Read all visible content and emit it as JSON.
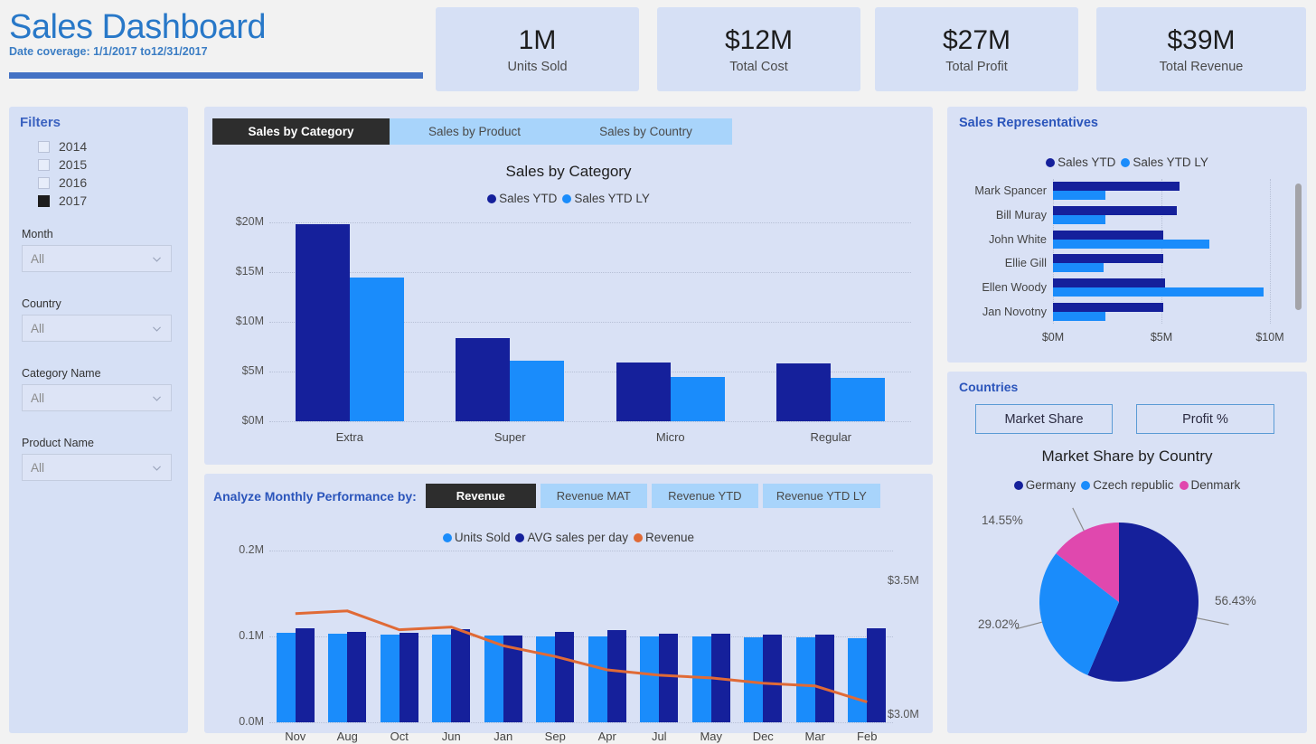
{
  "header": {
    "title": "Sales Dashboard",
    "subtitle": "Date coverage: 1/1/2017 to12/31/2017",
    "kpis": [
      {
        "value": "1M",
        "label": "Units Sold"
      },
      {
        "value": "$12M",
        "label": "Total Cost"
      },
      {
        "value": "$27M",
        "label": "Total Profit"
      },
      {
        "value": "$39M",
        "label": "Total Revenue"
      }
    ]
  },
  "sidebar": {
    "title": "Filters",
    "years": [
      {
        "label": "2014",
        "checked": false
      },
      {
        "label": "2015",
        "checked": false
      },
      {
        "label": "2016",
        "checked": false
      },
      {
        "label": "2017",
        "checked": true
      }
    ],
    "selects": [
      {
        "label": "Month",
        "value": "All"
      },
      {
        "label": "Country",
        "value": "All"
      },
      {
        "label": "Category Name",
        "value": "All"
      },
      {
        "label": "Product Name",
        "value": "All"
      }
    ]
  },
  "category_panel": {
    "tabs": [
      {
        "label": "Sales by Category",
        "active": true
      },
      {
        "label": "Sales by Product",
        "active": false
      },
      {
        "label": "Sales by Country",
        "active": false
      }
    ]
  },
  "monthly_panel": {
    "head_label": "Analyze Monthly Performance by:",
    "tabs": [
      {
        "label": "Revenue",
        "active": true
      },
      {
        "label": "Revenue MAT",
        "active": false
      },
      {
        "label": "Revenue YTD",
        "active": false
      },
      {
        "label": "Revenue YTD LY",
        "active": false
      }
    ]
  },
  "reps_panel": {
    "title": "Sales Representatives"
  },
  "countries_panel": {
    "title": "Countries",
    "buttons": [
      {
        "label": "Market Share"
      },
      {
        "label": "Profit %"
      }
    ]
  },
  "colors": {
    "navy": "#15209b",
    "blue": "#1a8cfb",
    "pink": "#e048ae",
    "orange": "#e06a36",
    "accent": "#2878c8",
    "rule": "#4472c4",
    "panel": "#d6e0f5",
    "page": "#f2f2f2"
  },
  "chart_data": [
    {
      "type": "bar",
      "id": "sales-by-category",
      "title": "Sales by Category",
      "xlabel": "",
      "ylabel": "",
      "ylim": [
        0,
        20
      ],
      "yticks": [
        "$0M",
        "$5M",
        "$10M",
        "$15M",
        "$20M"
      ],
      "ytick_values": [
        0,
        5,
        10,
        15,
        20
      ],
      "grid": true,
      "legend_position": "top",
      "categories": [
        "Extra",
        "Super",
        "Micro",
        "Regular"
      ],
      "series": [
        {
          "name": "Sales YTD",
          "color": "#15209b",
          "values": [
            19.8,
            8.4,
            5.9,
            5.8
          ]
        },
        {
          "name": "Sales YTD LY",
          "color": "#1a8cfb",
          "values": [
            14.5,
            6.1,
            4.5,
            4.4
          ]
        }
      ]
    },
    {
      "type": "bar",
      "id": "monthly-performance",
      "title": "",
      "ylabel": "",
      "ylim": [
        0,
        0.2
      ],
      "yticks": [
        "0.0M",
        "0.1M",
        "0.2M"
      ],
      "ytick_values": [
        0.0,
        0.1,
        0.2
      ],
      "y2lim": [
        3.0,
        3.5
      ],
      "y2ticks": [
        "$3.0M",
        "$3.5M"
      ],
      "y2tick_values": [
        3.0,
        3.5
      ],
      "grid": true,
      "legend_position": "top",
      "categories": [
        "Nov",
        "Aug",
        "Oct",
        "Jun",
        "Jan",
        "Sep",
        "Apr",
        "Jul",
        "May",
        "Dec",
        "Mar",
        "Feb"
      ],
      "series": [
        {
          "name": "Units Sold",
          "type": "bar",
          "color": "#1a8cfb",
          "axis": "left",
          "values": [
            0.104,
            0.103,
            0.102,
            0.102,
            0.101,
            0.1,
            0.1,
            0.1,
            0.1,
            0.099,
            0.099,
            0.098
          ]
        },
        {
          "name": "AVG sales per day",
          "type": "bar",
          "color": "#15209b",
          "axis": "left",
          "values": [
            0.11,
            0.105,
            0.104,
            0.108,
            0.101,
            0.105,
            0.107,
            0.103,
            0.103,
            0.102,
            0.102,
            0.11
          ]
        },
        {
          "name": "Revenue",
          "type": "line",
          "color": "#e06a36",
          "axis": "right",
          "values": [
            3.38,
            3.39,
            3.32,
            3.33,
            3.26,
            3.22,
            3.17,
            3.15,
            3.14,
            3.12,
            3.11,
            3.05
          ]
        }
      ]
    },
    {
      "type": "bar",
      "id": "sales-representatives",
      "orientation": "horizontal",
      "title": "",
      "xlim": [
        0,
        10
      ],
      "xticks": [
        "$0M",
        "$5M",
        "$10M"
      ],
      "xtick_values": [
        0,
        5,
        10
      ],
      "grid": true,
      "legend_position": "top",
      "categories": [
        "Mark Spancer",
        "Bill Muray",
        "John White",
        "Ellie Gill",
        "Ellen Woody",
        "Jan Novotny"
      ],
      "series": [
        {
          "name": "Sales YTD",
          "color": "#15209b",
          "values": [
            5.85,
            5.7,
            5.1,
            5.1,
            5.15,
            5.1
          ]
        },
        {
          "name": "Sales YTD LY",
          "color": "#1a8cfb",
          "values": [
            2.4,
            2.4,
            7.2,
            2.35,
            9.7,
            2.4
          ]
        }
      ]
    },
    {
      "type": "pie",
      "id": "market-share-by-country",
      "title": "Market Share by Country",
      "legend_position": "top",
      "labels": [
        "Germany",
        "Czech republic",
        "Denmark"
      ],
      "values": [
        56.43,
        29.02,
        14.55
      ],
      "value_labels": [
        "56.43%",
        "29.02%",
        "14.55%"
      ],
      "colors": [
        "#15209b",
        "#1a8cfb",
        "#e048ae"
      ]
    }
  ]
}
